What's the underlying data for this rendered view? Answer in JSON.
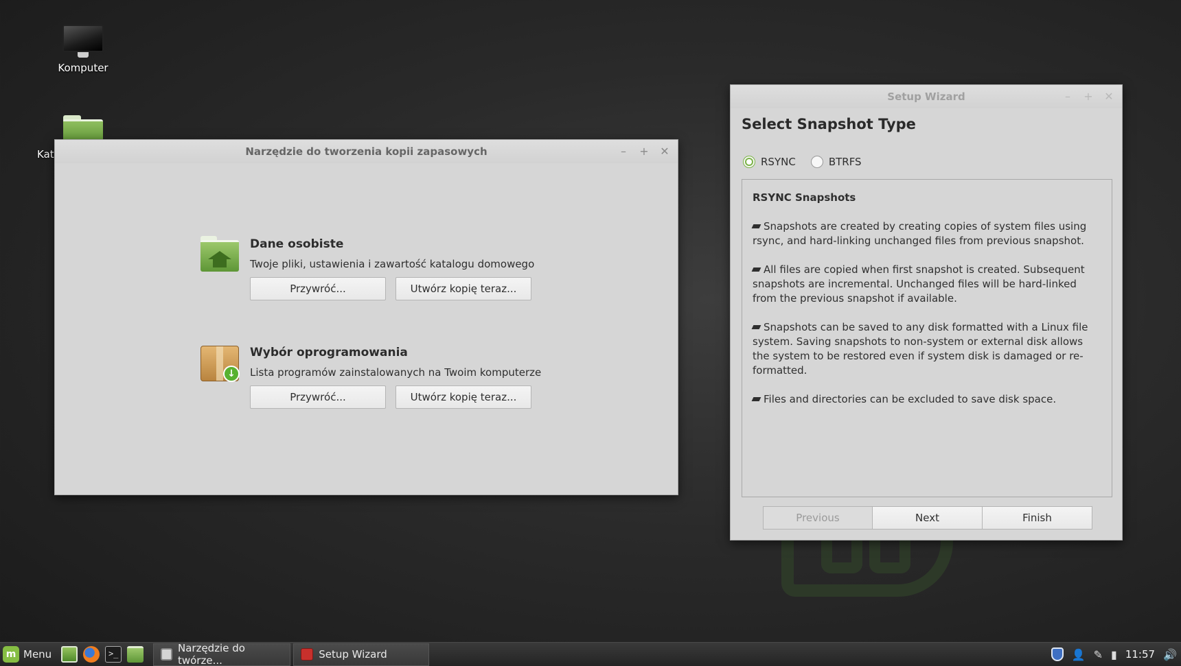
{
  "desktop": {
    "icons": [
      {
        "label": "Komputer"
      },
      {
        "label": "Kat"
      }
    ]
  },
  "backup_window": {
    "title": "Narzędzie do tworzenia kopii zapasowych",
    "controls": {
      "minimize": "–",
      "maximize": "+",
      "close": "✕"
    },
    "sections": [
      {
        "title": "Dane osobiste",
        "description": "Twoje pliki, ustawienia i zawartość katalogu domowego",
        "restore_label": "Przywróć...",
        "backup_label": "Utwórz kopię teraz..."
      },
      {
        "title": "Wybór oprogramowania",
        "description": "Lista programów zainstalowanych na Twoim komputerze",
        "restore_label": "Przywróć...",
        "backup_label": "Utwórz kopię teraz..."
      }
    ]
  },
  "wizard": {
    "title": "Setup Wizard",
    "controls": {
      "minimize": "–",
      "maximize": "+",
      "close": "✕"
    },
    "heading": "Select Snapshot Type",
    "options": [
      {
        "label": "RSYNC",
        "selected": true
      },
      {
        "label": "BTRFS",
        "selected": false
      }
    ],
    "info": {
      "title": "RSYNC Snapshots",
      "bullets": [
        "Snapshots are created by creating copies of system files using rsync, and hard-linking unchanged files from previous snapshot.",
        "All files are copied when first snapshot is created. Subsequent snapshots are incremental. Unchanged files will be hard-linked from the previous snapshot if available.",
        "Snapshots can be saved to any disk formatted with a Linux file system. Saving snapshots to non-system or external disk allows the system to be restored even if system disk is damaged or re-formatted.",
        "Files and directories can be excluded to save disk space."
      ]
    },
    "buttons": {
      "previous": "Previous",
      "next": "Next",
      "finish": "Finish"
    }
  },
  "taskbar": {
    "menu_label": "Menu",
    "tasks": [
      {
        "label": "Narzędzie do twórze..."
      },
      {
        "label": "Setup Wizard"
      }
    ],
    "tray_icons": [
      "shield-icon",
      "user-icon",
      "pen-icon",
      "battery-icon",
      "volume-icon"
    ],
    "clock": "11:57"
  },
  "colors": {
    "accent_green": "#86be43",
    "window_bg": "#d6d6d6",
    "taskbar_bg": "#2e2e2e"
  }
}
